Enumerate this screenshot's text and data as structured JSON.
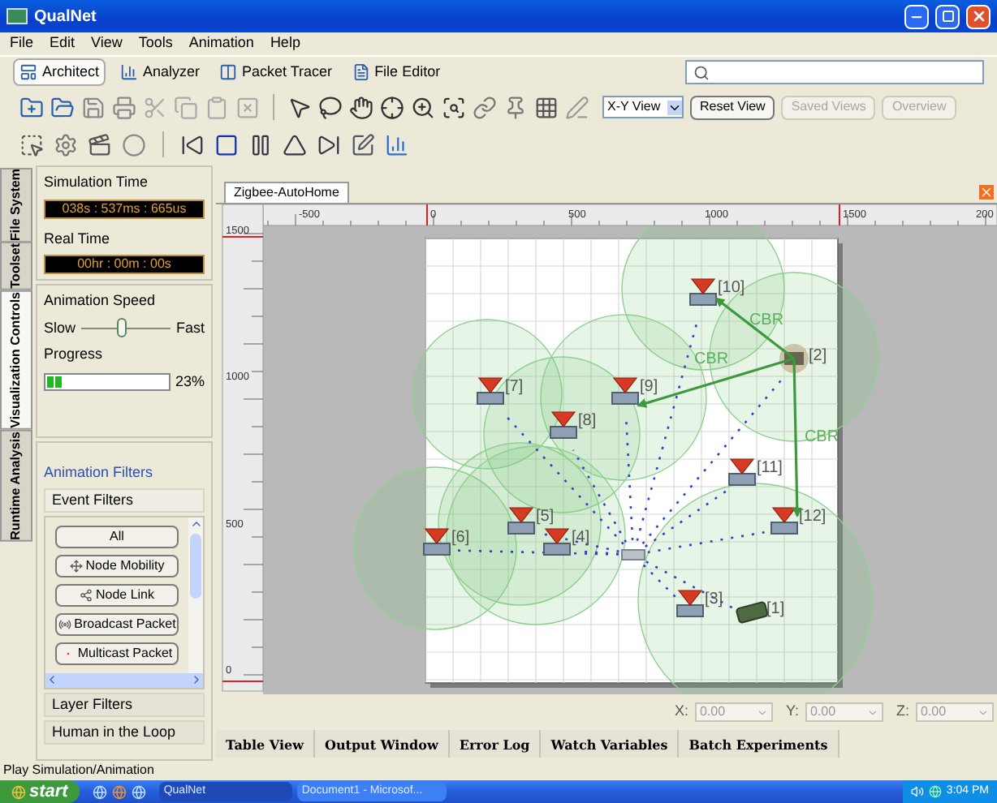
{
  "window": {
    "title": "QualNet"
  },
  "menu": [
    "File",
    "Edit",
    "View",
    "Tools",
    "Animation",
    "Help"
  ],
  "perspectives": [
    {
      "label": "Architect",
      "selected": true
    },
    {
      "label": "Analyzer",
      "selected": false
    },
    {
      "label": "Packet Tracer",
      "selected": false
    },
    {
      "label": "File Editor",
      "selected": false
    }
  ],
  "view_toolbar": {
    "view_mode": "X-Y View",
    "buttons": [
      {
        "label": "Reset View",
        "disabled": false
      },
      {
        "label": "Saved Views",
        "disabled": true
      },
      {
        "label": "Overview",
        "disabled": true
      }
    ]
  },
  "side_tabs": [
    {
      "label": "File System",
      "selected": false
    },
    {
      "label": "Toolset",
      "selected": false
    },
    {
      "label": "Visualization Controls",
      "selected": true
    },
    {
      "label": "Runtime Analysis",
      "selected": false
    }
  ],
  "visualization": {
    "simulation_time_label": "Simulation Time",
    "simulation_time": "038s : 537ms : 665us",
    "real_time_label": "Real Time",
    "real_time": "00hr : 00m : 00s",
    "speed": {
      "label": "Animation Speed",
      "min": "Slow",
      "max": "Fast",
      "level": 0.45
    },
    "progress": {
      "label": "Progress",
      "level": 0.14,
      "reading": "23%"
    }
  },
  "filters": {
    "title": "Animation Filters",
    "sections": [
      {
        "label": "Event Filters",
        "expanded": true
      },
      {
        "label": "Layer Filters",
        "expanded": false
      },
      {
        "label": "Human in the Loop",
        "expanded": false
      }
    ],
    "event_items": [
      "All",
      "Node Mobility",
      "Node Link",
      "Broadcast Packet",
      "Multicast Packet"
    ]
  },
  "canvas": {
    "tab": "Zigbee-AutoHome",
    "x_ruler": [
      "-500",
      "0",
      "500",
      "1000",
      "1500",
      "200"
    ],
    "y_ruler": [
      "1500",
      "1000",
      "500",
      "0"
    ],
    "nodes": [
      {
        "kind": "sensor",
        "label": "[10]"
      },
      {
        "kind": "gateway",
        "label": "[2]"
      },
      {
        "kind": "sensor",
        "label": "[7]"
      },
      {
        "kind": "sensor",
        "label": "[9]"
      },
      {
        "kind": "sensor",
        "label": "[8]"
      },
      {
        "kind": "sensor",
        "label": "[11]"
      },
      {
        "kind": "sensor",
        "label": "[5]"
      },
      {
        "kind": "sensor",
        "label": "[12]"
      },
      {
        "kind": "sensor",
        "label": "[6]"
      },
      {
        "kind": "sensor",
        "label": "[4]"
      },
      {
        "kind": "coordinator"
      },
      {
        "kind": "sensor",
        "label": "[3]"
      },
      {
        "kind": "device",
        "label": "[1]"
      }
    ],
    "links": [
      {
        "label": "CBR"
      },
      {
        "label": "CBR"
      },
      {
        "label": "CBR"
      }
    ],
    "coords": [
      {
        "label": "X:",
        "value": "0.00"
      },
      {
        "label": "Y:",
        "value": "0.00"
      },
      {
        "label": "Z:",
        "value": "0.00"
      }
    ]
  },
  "bottom_tabs": [
    "Table View",
    "Output Window",
    "Error Log",
    "Watch Variables",
    "Batch Experiments"
  ],
  "status_bar": "Play Simulation/Animation",
  "taskbar": {
    "start": "start",
    "tasks": [
      "QualNet",
      "Document1 - Microsof..."
    ],
    "clock": "3:04 PM"
  }
}
